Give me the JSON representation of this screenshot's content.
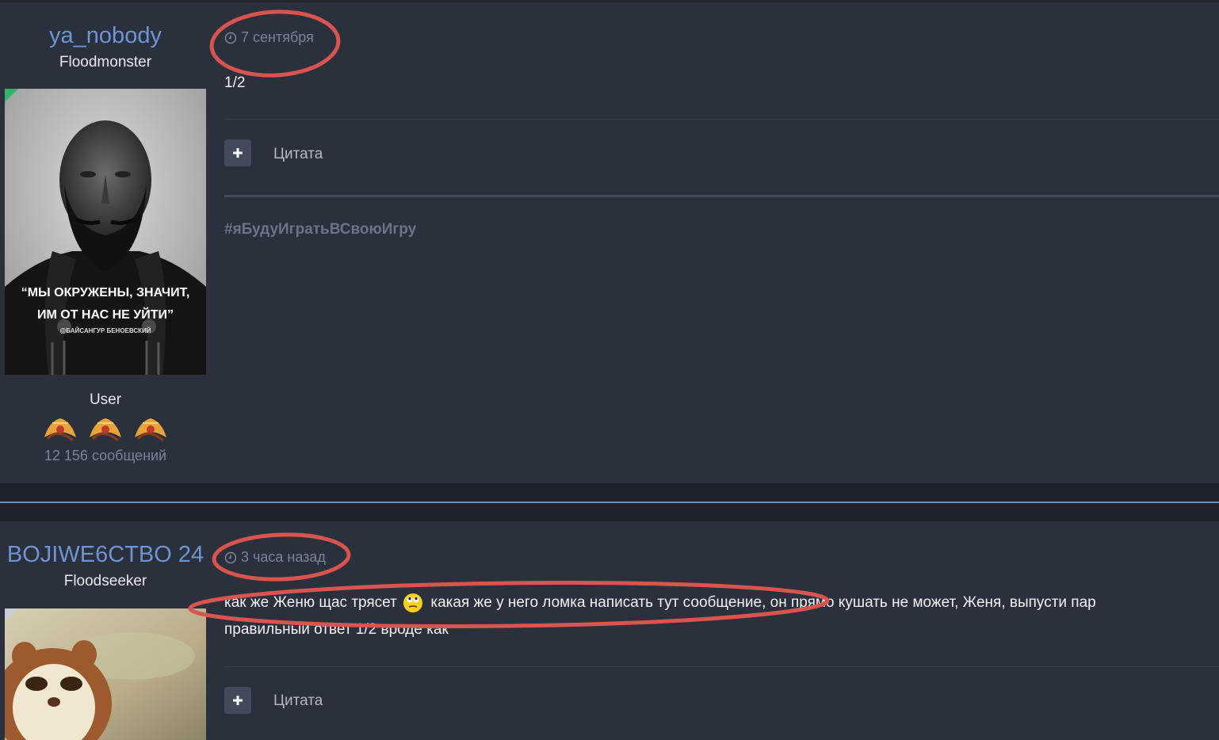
{
  "posts": [
    {
      "author": {
        "username": "ya_nobody",
        "title": "Floodmonster",
        "group": "User",
        "post_count": "12 156 сообщений",
        "avatar_caption_line1": "“МЫ ОКРУЖЕНЫ, ЗНАЧИТ,",
        "avatar_caption_line2": "ИМ ОТ НАС НЕ УЙТИ”",
        "avatar_caption_line3": "@БАЙСАНГУР БЕНОЕВСКИЙ"
      },
      "date": "7 сентября",
      "message": "1/2",
      "quote_label": "Цитата",
      "signature": "#яБудуИгратьВСвоюИгру"
    },
    {
      "author": {
        "username": "BOJIWE6CTBO 24",
        "title": "Floodseeker"
      },
      "date": "3 часа назад",
      "message_part1": "как же Женю щас трясет",
      "message_part2": "какая же у него ломка написать тут сообщение, он прямо кушать не может, Женя, выпусти пар",
      "message_line2": "правильный ответ 1/2 вроде как",
      "quote_label": "Цитата"
    }
  ],
  "colors": {
    "background": "#2b303d",
    "username": "#6f93d3",
    "muted": "#7c8394",
    "annotation": "#d9534f",
    "separator": "#6c8fb3"
  },
  "icons": [
    "clock-icon",
    "plus-icon",
    "rank-icon",
    "rolling-eyes-emoji"
  ]
}
